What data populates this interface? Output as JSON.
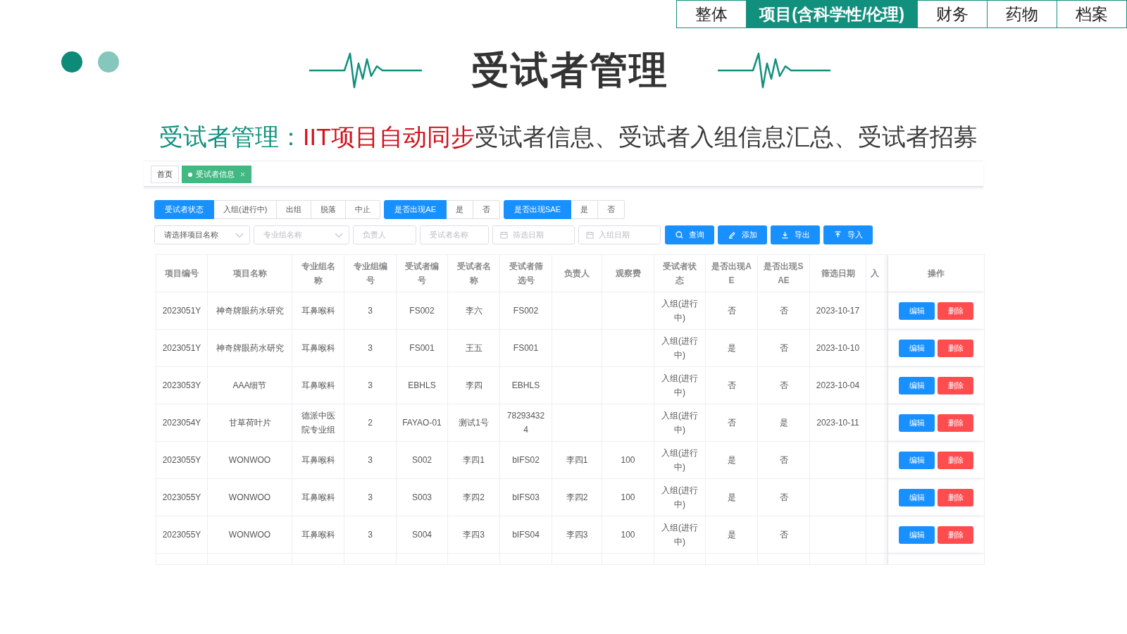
{
  "nav_tabs": [
    {
      "label": "整体",
      "selected": false
    },
    {
      "label": "项目(含科学性/伦理)",
      "selected": true
    },
    {
      "label": "财务",
      "selected": false
    },
    {
      "label": "药物",
      "selected": false
    },
    {
      "label": "档案",
      "selected": false
    }
  ],
  "title": "受试者管理",
  "subtitle": [
    {
      "text": "受试者管理：",
      "kind": "label"
    },
    {
      "text": "IIT项目自动同步",
      "kind": "highlight"
    },
    {
      "text": "受试者信息、受试者入组信息汇总、受试者招募",
      "kind": "plain"
    }
  ],
  "app": {
    "page_tabs": [
      {
        "label": "首页",
        "selected": false
      },
      {
        "label": "受试者信息",
        "selected": true
      }
    ],
    "filter_groups": [
      {
        "label": "受试者状态",
        "options": [
          "入组(进行中)",
          "出组",
          "脱落",
          "中止"
        ]
      },
      {
        "label": "是否出现AE",
        "options": [
          "是",
          "否"
        ]
      },
      {
        "label": "是否出现SAE",
        "options": [
          "是",
          "否"
        ]
      }
    ],
    "filters": [
      {
        "kind": "select",
        "value": "请选择项目名称"
      },
      {
        "kind": "select",
        "placeholder": "专业组名称"
      },
      {
        "kind": "input",
        "placeholder": "负责人"
      },
      {
        "kind": "input",
        "placeholder": "受试者名称"
      },
      {
        "kind": "date",
        "placeholder": "筛选日期"
      },
      {
        "kind": "date",
        "placeholder": "入组日期"
      }
    ],
    "buttons": [
      {
        "label": "查询",
        "kind": "search"
      },
      {
        "label": "添加",
        "kind": "add"
      },
      {
        "label": "导出",
        "kind": "export"
      },
      {
        "label": "导入",
        "kind": "import"
      }
    ],
    "table": {
      "columns": [
        "项目编号",
        "项目名称",
        "专业组名称",
        "专业组编号",
        "受试者编号",
        "受试者名称",
        "受试者筛选号",
        "负责人",
        "观察费",
        "受试者状态",
        "是否出现AE",
        "是否出现SAE",
        "筛选日期",
        "入",
        "操作"
      ],
      "rows": [
        {
          "project_id": "2023051Y",
          "project_name": "神奇牌眼药水研究",
          "group_name": "耳鼻喉科",
          "group_no": "3",
          "subject_no": "FS002",
          "subject_name": "李六",
          "screening_no": "FS002",
          "status": "入组(进行中)",
          "ae": "否",
          "sae": "否",
          "screening_date": "2023-10-17",
          "actions": [
            {
              "label": "编辑",
              "kind": "edit"
            },
            {
              "label": "删除",
              "kind": "delete"
            }
          ]
        },
        {
          "project_id": "2023051Y",
          "project_name": "神奇牌眼药水研究",
          "group_name": "耳鼻喉科",
          "group_no": "3",
          "subject_no": "FS001",
          "subject_name": "王五",
          "screening_no": "FS001",
          "status": "入组(进行中)",
          "ae": "是",
          "sae": "否",
          "screening_date": "2023-10-10",
          "actions": [
            {
              "label": "编辑",
              "kind": "edit"
            },
            {
              "label": "删除",
              "kind": "delete"
            }
          ]
        },
        {
          "project_id": "2023053Y",
          "project_name": "AAA细节",
          "group_name": "耳鼻喉科",
          "group_no": "3",
          "subject_no": "EBHLS",
          "subject_name": "李四",
          "screening_no": "EBHLS",
          "status": "入组(进行中)",
          "ae": "否",
          "sae": "否",
          "screening_date": "2023-10-04",
          "actions": [
            {
              "label": "编辑",
              "kind": "edit"
            },
            {
              "label": "删除",
              "kind": "delete"
            }
          ]
        },
        {
          "project_id": "2023054Y",
          "project_name": "甘草荷叶片",
          "group_name": "德派中医院专业组",
          "group_no": "2",
          "subject_no": "FAYAO-01",
          "subject_name": "测试1号",
          "screening_no": "782934324",
          "status": "入组(进行中)",
          "ae": "否",
          "sae": "是",
          "screening_date": "2023-10-11",
          "actions": [
            {
              "label": "编辑",
              "kind": "edit"
            },
            {
              "label": "删除",
              "kind": "delete"
            }
          ]
        },
        {
          "project_id": "2023055Y",
          "project_name": "WONWOO",
          "group_name": "耳鼻喉科",
          "group_no": "3",
          "subject_no": "S002",
          "subject_name": "李四1",
          "screening_no": "bIFS02",
          "owner": "李四1",
          "fee": "100",
          "status": "入组(进行中)",
          "ae": "是",
          "sae": "否",
          "actions": [
            {
              "label": "编辑",
              "kind": "edit"
            },
            {
              "label": "删除",
              "kind": "delete"
            }
          ]
        },
        {
          "project_id": "2023055Y",
          "project_name": "WONWOO",
          "group_name": "耳鼻喉科",
          "group_no": "3",
          "subject_no": "S003",
          "subject_name": "李四2",
          "screening_no": "bIFS03",
          "owner": "李四2",
          "fee": "100",
          "status": "入组(进行中)",
          "ae": "是",
          "sae": "否",
          "actions": [
            {
              "label": "编辑",
              "kind": "edit"
            },
            {
              "label": "删除",
              "kind": "delete"
            }
          ]
        },
        {
          "project_id": "2023055Y",
          "project_name": "WONWOO",
          "group_name": "耳鼻喉科",
          "group_no": "3",
          "subject_no": "S004",
          "subject_name": "李四3",
          "screening_no": "bIFS04",
          "owner": "李四3",
          "fee": "100",
          "status": "入组(进行中)",
          "ae": "是",
          "sae": "否",
          "actions": [
            {
              "label": "编辑",
              "kind": "edit"
            },
            {
              "label": "删除",
              "kind": "delete"
            }
          ]
        }
      ]
    }
  }
}
